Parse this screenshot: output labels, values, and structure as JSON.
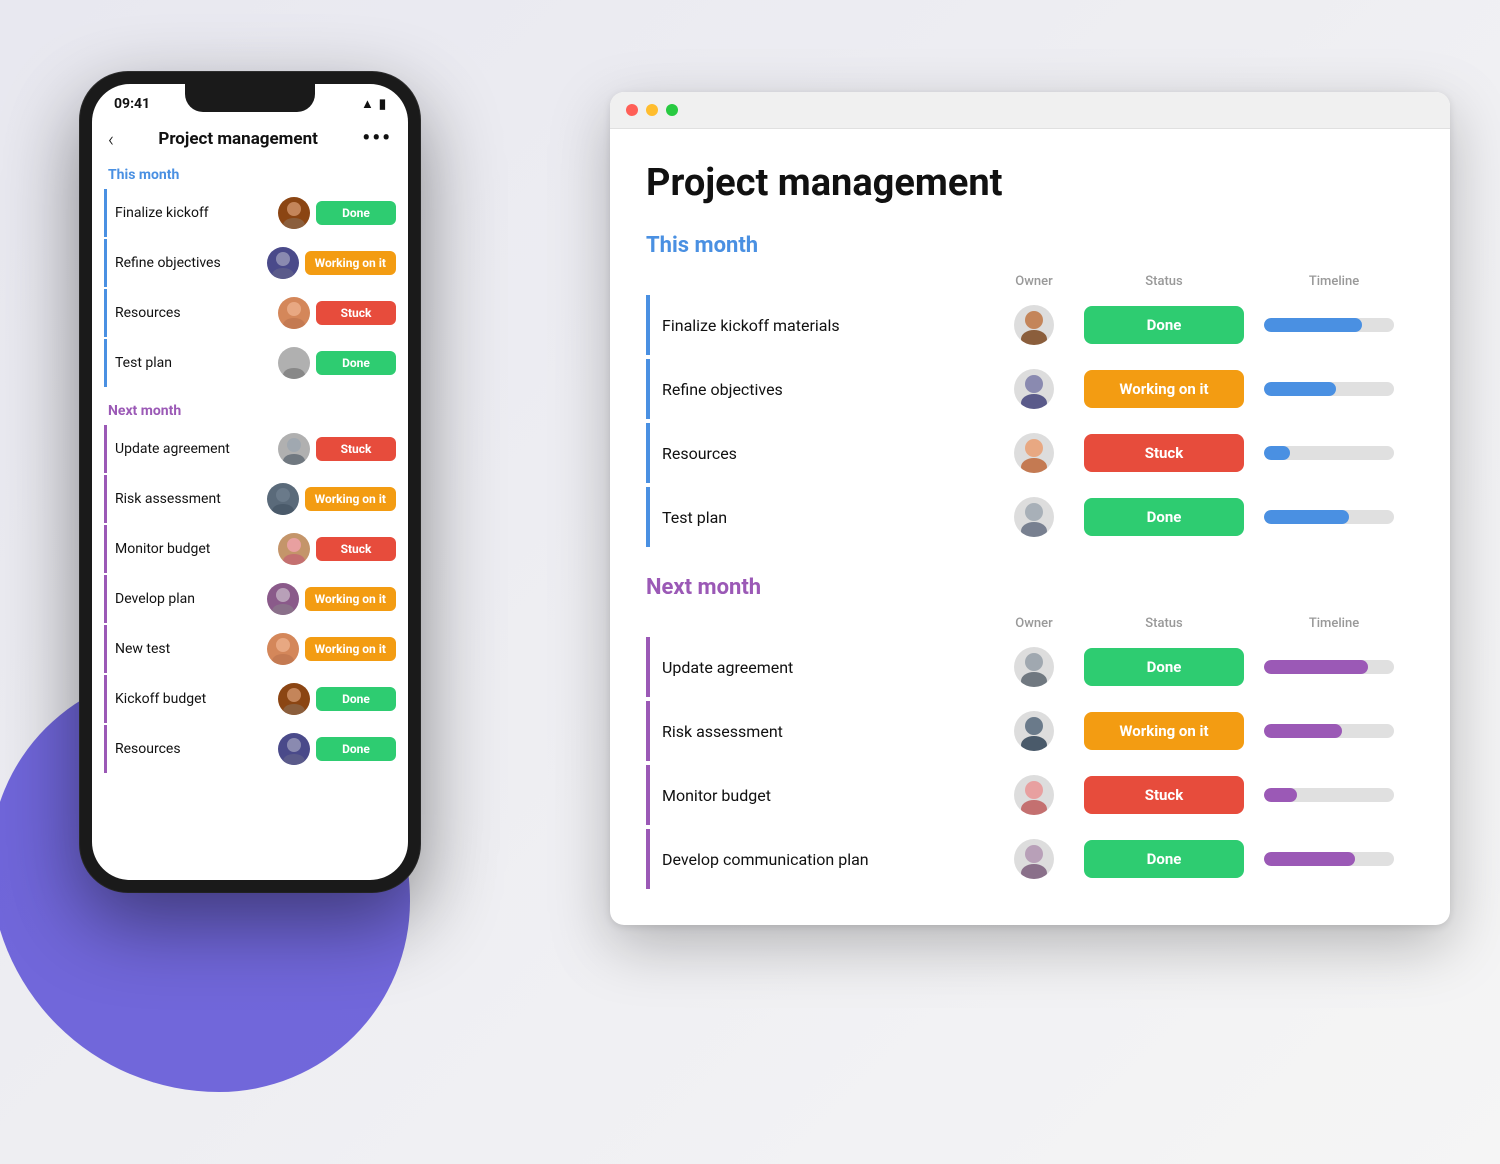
{
  "colors": {
    "blue": "#4A90E2",
    "purple": "#9B59B6",
    "done": "#2ECC71",
    "working": "#F39C12",
    "stuck": "#E74C3C",
    "white": "#ffffff"
  },
  "phone": {
    "time": "09:41",
    "title": "Project management",
    "back_label": "‹",
    "more_label": "•••",
    "this_month_label": "This month",
    "next_month_label": "Next month",
    "this_month_rows": [
      {
        "name": "Finalize kickoff",
        "status": "Done",
        "status_type": "done",
        "avatar_id": "1"
      },
      {
        "name": "Refine objectives",
        "status": "Working on it",
        "status_type": "working",
        "avatar_id": "2"
      },
      {
        "name": "Resources",
        "status": "Stuck",
        "status_type": "stuck",
        "avatar_id": "3"
      },
      {
        "name": "Test plan",
        "status": "Done",
        "status_type": "done",
        "avatar_id": "4"
      }
    ],
    "next_month_rows": [
      {
        "name": "Update agreement",
        "status": "Stuck",
        "status_type": "stuck",
        "avatar_id": "5"
      },
      {
        "name": "Risk assessment",
        "status": "Working on it",
        "status_type": "working",
        "avatar_id": "6"
      },
      {
        "name": "Monitor budget",
        "status": "Stuck",
        "status_type": "stuck",
        "avatar_id": "7"
      },
      {
        "name": "Develop plan",
        "status": "Working on it",
        "status_type": "working",
        "avatar_id": "8"
      },
      {
        "name": "New test",
        "status": "Working on it",
        "status_type": "working",
        "avatar_id": "3"
      },
      {
        "name": "Kickoff budget",
        "status": "Done",
        "status_type": "done",
        "avatar_id": "1"
      },
      {
        "name": "Resources",
        "status": "Done",
        "status_type": "done",
        "avatar_id": "2"
      }
    ]
  },
  "desktop": {
    "page_title": "Project management",
    "this_month_label": "This month",
    "next_month_label": "Next month",
    "col_owner": "Owner",
    "col_status": "Status",
    "col_timeline": "Timeline",
    "this_month_rows": [
      {
        "name": "Finalize kickoff materials",
        "status": "Done",
        "status_type": "done",
        "avatar_id": "1",
        "timeline_pct": 75
      },
      {
        "name": "Refine objectives",
        "status": "Working on it",
        "status_type": "working",
        "avatar_id": "2",
        "timeline_pct": 55
      },
      {
        "name": "Resources",
        "status": "Stuck",
        "status_type": "stuck",
        "avatar_id": "3",
        "timeline_pct": 20
      },
      {
        "name": "Test plan",
        "status": "Done",
        "status_type": "done",
        "avatar_id": "4",
        "timeline_pct": 65
      }
    ],
    "next_month_rows": [
      {
        "name": "Update agreement",
        "status": "Done",
        "status_type": "done",
        "avatar_id": "5",
        "timeline_pct": 80
      },
      {
        "name": "Risk assessment",
        "status": "Working on it",
        "status_type": "working",
        "avatar_id": "6",
        "timeline_pct": 60
      },
      {
        "name": "Monitor budget",
        "status": "Stuck",
        "status_type": "stuck",
        "avatar_id": "7",
        "timeline_pct": 25
      },
      {
        "name": "Develop communication plan",
        "status": "Done",
        "status_type": "done",
        "avatar_id": "8",
        "timeline_pct": 70
      }
    ]
  }
}
